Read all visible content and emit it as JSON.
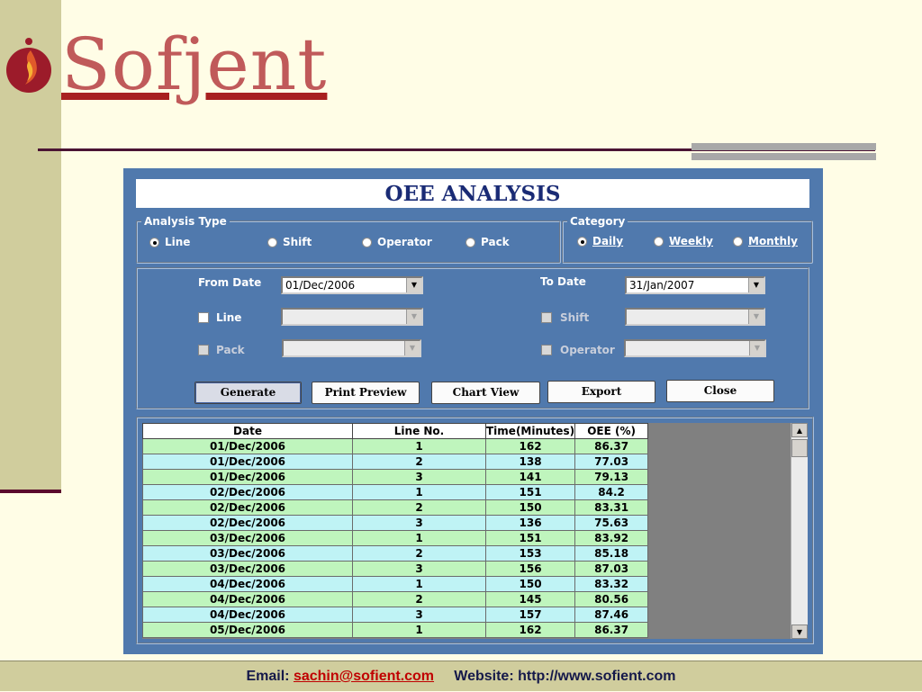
{
  "logo": {
    "text": "Sofjent"
  },
  "window": {
    "title": "OEE ANALYSIS"
  },
  "analysis_type": {
    "legend": "Analysis Type",
    "options": [
      "Line",
      "Shift",
      "Operator",
      "Pack"
    ],
    "selected": "Line"
  },
  "category": {
    "legend": "Category",
    "options": [
      "Daily",
      "Weekly",
      "Monthly"
    ],
    "selected": "Daily"
  },
  "filters": {
    "from_date_label": "From Date",
    "from_date_value": "01/Dec/2006",
    "to_date_label": "To Date",
    "to_date_value": "31/Jan/2007",
    "line_label": "Line",
    "shift_label": "Shift",
    "pack_label": "Pack",
    "operator_label": "Operator"
  },
  "buttons": {
    "generate": "Generate",
    "print_preview": "Print Preview",
    "chart_view": "Chart View",
    "export": "Export",
    "close": "Close"
  },
  "table": {
    "columns": [
      "Date",
      "Line No.",
      "Time(Minutes)",
      "OEE (%)"
    ],
    "rows": [
      [
        "01/Dec/2006",
        "1",
        "162",
        "86.37"
      ],
      [
        "01/Dec/2006",
        "2",
        "138",
        "77.03"
      ],
      [
        "01/Dec/2006",
        "3",
        "141",
        "79.13"
      ],
      [
        "02/Dec/2006",
        "1",
        "151",
        "84.2"
      ],
      [
        "02/Dec/2006",
        "2",
        "150",
        "83.31"
      ],
      [
        "02/Dec/2006",
        "3",
        "136",
        "75.63"
      ],
      [
        "03/Dec/2006",
        "1",
        "151",
        "83.92"
      ],
      [
        "03/Dec/2006",
        "2",
        "153",
        "85.18"
      ],
      [
        "03/Dec/2006",
        "3",
        "156",
        "87.03"
      ],
      [
        "04/Dec/2006",
        "1",
        "150",
        "83.32"
      ],
      [
        "04/Dec/2006",
        "2",
        "145",
        "80.56"
      ],
      [
        "04/Dec/2006",
        "3",
        "157",
        "87.46"
      ],
      [
        "05/Dec/2006",
        "1",
        "162",
        "86.37"
      ]
    ]
  },
  "footer": {
    "email_label": "Email:",
    "email": "sachin@sofient.com",
    "website_label": "Website:",
    "website": "http://www.sofient.com"
  },
  "colors": {
    "app_background": "#5079ad",
    "row_green": "#bff5bd",
    "row_cyan": "#bff3f5",
    "title_text": "#1a2b75",
    "footer_link": "#c00000"
  }
}
